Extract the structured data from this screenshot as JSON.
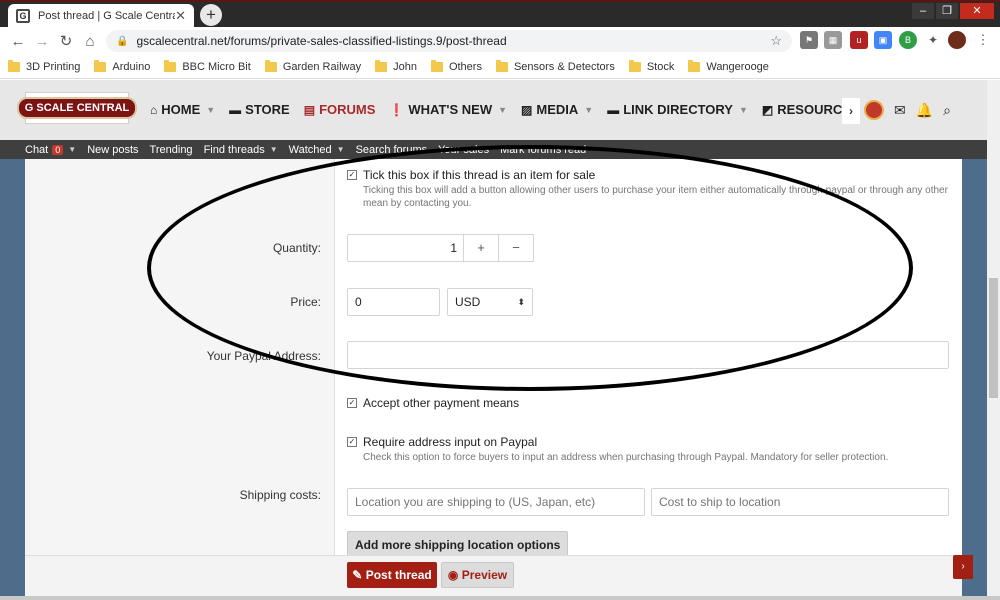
{
  "browser": {
    "tab_title": "Post thread | G Scale Central",
    "tab_favicon": "G",
    "url": "gscalecentral.net/forums/private-sales-classified-listings.9/post-thread",
    "bookmarks": [
      "3D Printing",
      "Arduino",
      "BBC Micro Bit",
      "Garden Railway",
      "John",
      "Others",
      "Sensors & Detectors",
      "Stock",
      "Wangerooge"
    ]
  },
  "site": {
    "logo_text": "G SCALE CENTRAL",
    "nav": [
      {
        "label": "HOME",
        "icon": "home-icon"
      },
      {
        "label": "STORE",
        "icon": "folder-icon"
      },
      {
        "label": "FORUMS",
        "icon": "chat-icon"
      },
      {
        "label": "WHAT'S NEW",
        "icon": "alert-icon"
      },
      {
        "label": "MEDIA",
        "icon": "image-icon"
      },
      {
        "label": "LINK DIRECTORY",
        "icon": "folder-icon"
      },
      {
        "label": "RESOURCES",
        "icon": "external-icon"
      }
    ],
    "subnav": {
      "chat": "Chat",
      "chat_count": "0",
      "new_posts": "New posts",
      "trending": "Trending",
      "find_threads": "Find threads",
      "watched": "Watched",
      "search_forums": "Search forums",
      "your_sales": "Your sales",
      "mark_read": "Mark forums read"
    }
  },
  "form": {
    "for_sale_label": "Tick this box if this thread is an item for sale",
    "for_sale_hint": "Ticking this box will add a button allowing other users to purchase your item either automatically through paypal or through any other mean by contacting you.",
    "quantity_label": "Quantity:",
    "quantity_value": "1",
    "plus": "+",
    "minus": "−",
    "price_label": "Price:",
    "price_value": "0",
    "currency": "USD",
    "paypal_label": "Your Paypal Address:",
    "other_payment_label": "Accept other payment means",
    "require_address_label": "Require address input on Paypal",
    "require_address_hint": "Check this option to force buyers to input an address when purchasing through Paypal. Mandatory for seller protection.",
    "shipping_label": "Shipping costs:",
    "shipping_location_placeholder": "Location you are shipping to (US, Japan, etc)",
    "shipping_cost_placeholder": "Cost to ship to location",
    "add_shipping": "Add more shipping location options",
    "post_thread": "Post thread",
    "preview": "Preview"
  }
}
